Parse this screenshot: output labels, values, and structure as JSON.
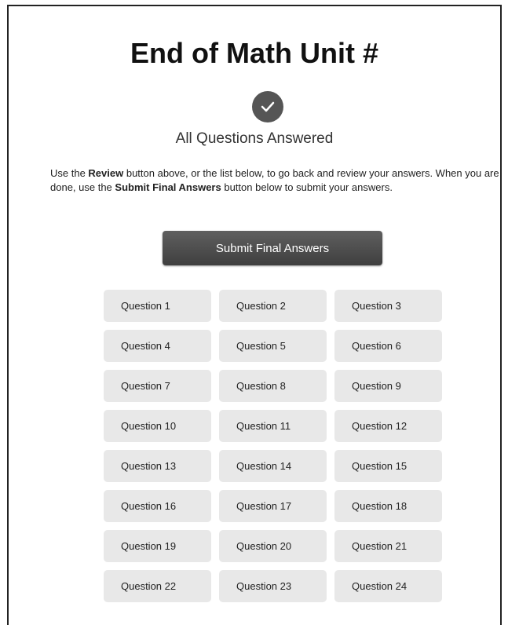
{
  "title": "End of Math Unit #",
  "status_icon": "checkmark-icon",
  "status_text": "All Questions Answered",
  "instructions": {
    "part1": "Use the ",
    "review_bold": "Review",
    "part2": " button above, or the list below, to go back and review your answers. When you are done, use the ",
    "submit_bold": "Submit Final Answers",
    "part3": " button below to submit your answers."
  },
  "submit_label": "Submit Final Answers",
  "questions": [
    "Question 1",
    "Question 2",
    "Question 3",
    "Question 4",
    "Question 5",
    "Question 6",
    "Question 7",
    "Question 8",
    "Question 9",
    "Question 10",
    "Question 11",
    "Question 12",
    "Question 13",
    "Question 14",
    "Question 15",
    "Question 16",
    "Question 17",
    "Question 18",
    "Question 19",
    "Question 20",
    "Question 21",
    "Question 22",
    "Question 23",
    "Question 24"
  ]
}
